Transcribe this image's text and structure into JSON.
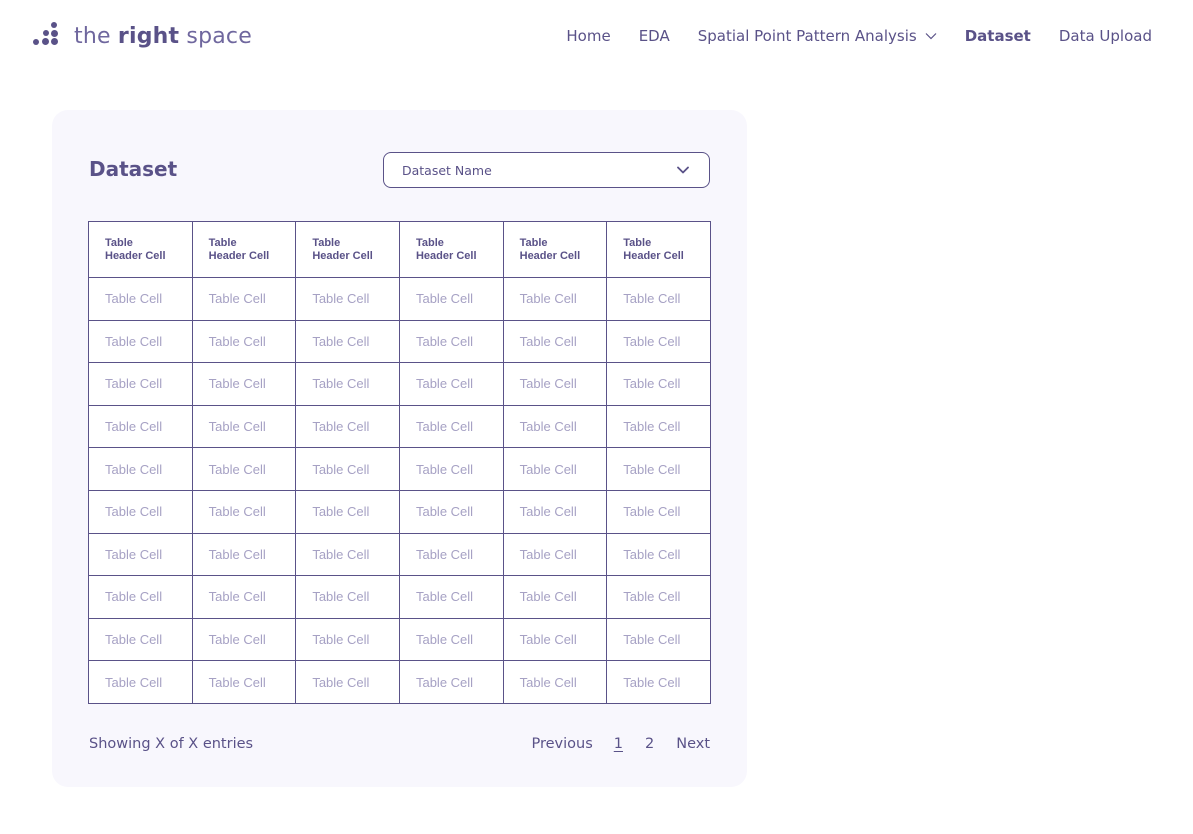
{
  "brand": {
    "text_light_1": "the ",
    "text_bold": "right",
    "text_light_2": " space"
  },
  "nav": {
    "items": [
      {
        "label": "Home"
      },
      {
        "label": "EDA"
      },
      {
        "label": "Spatial Point Pattern Analysis"
      },
      {
        "label": "Dataset"
      },
      {
        "label": "Data Upload"
      }
    ]
  },
  "card": {
    "title": "Dataset",
    "select": {
      "value": "Dataset Name"
    },
    "table": {
      "headers": [
        "Table\nHeader Cell",
        "Table\nHeader Cell",
        "Table\nHeader Cell",
        "Table\nHeader Cell",
        "Table\nHeader Cell",
        "Table\nHeader Cell"
      ],
      "rows": [
        [
          "Table Cell",
          "Table Cell",
          "Table Cell",
          "Table Cell",
          "Table Cell",
          "Table Cell"
        ],
        [
          "Table Cell",
          "Table Cell",
          "Table Cell",
          "Table Cell",
          "Table Cell",
          "Table Cell"
        ],
        [
          "Table Cell",
          "Table Cell",
          "Table Cell",
          "Table Cell",
          "Table Cell",
          "Table Cell"
        ],
        [
          "Table Cell",
          "Table Cell",
          "Table Cell",
          "Table Cell",
          "Table Cell",
          "Table Cell"
        ],
        [
          "Table Cell",
          "Table Cell",
          "Table Cell",
          "Table Cell",
          "Table Cell",
          "Table Cell"
        ],
        [
          "Table Cell",
          "Table Cell",
          "Table Cell",
          "Table Cell",
          "Table Cell",
          "Table Cell"
        ],
        [
          "Table Cell",
          "Table Cell",
          "Table Cell",
          "Table Cell",
          "Table Cell",
          "Table Cell"
        ],
        [
          "Table Cell",
          "Table Cell",
          "Table Cell",
          "Table Cell",
          "Table Cell",
          "Table Cell"
        ],
        [
          "Table Cell",
          "Table Cell",
          "Table Cell",
          "Table Cell",
          "Table Cell",
          "Table Cell"
        ],
        [
          "Table Cell",
          "Table Cell",
          "Table Cell",
          "Table Cell",
          "Table Cell",
          "Table Cell"
        ]
      ]
    },
    "entries_text": "Showing X of X entries",
    "pagination": {
      "previous": "Previous",
      "pages": [
        "1",
        "2"
      ],
      "next": "Next"
    }
  },
  "colors": {
    "primary": "#5a5288",
    "card_bg": "#f8f7fd",
    "cell_text": "#a6a1c4"
  },
  "icons": {
    "logo": "dots-logo-icon",
    "nav_dropdown": "chevron-down-icon",
    "select_dropdown": "chevron-down-icon"
  }
}
